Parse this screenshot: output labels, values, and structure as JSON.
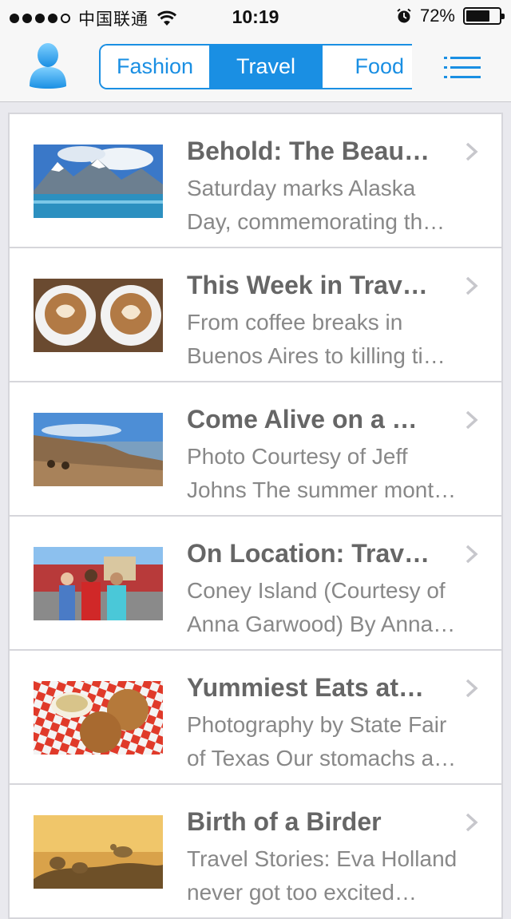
{
  "status_bar": {
    "carrier": "中国联通",
    "time": "10:19",
    "battery_text": "72%",
    "battery_level": 0.72
  },
  "nav": {
    "tabs": [
      {
        "label": "Fashion",
        "active": false
      },
      {
        "label": "Travel",
        "active": true
      },
      {
        "label": "Food",
        "active": false
      }
    ],
    "accent_color": "#1a8fe3"
  },
  "articles": [
    {
      "title": "Behold: The Beau…",
      "desc_line1": "Saturday marks Alaska",
      "desc_line2": "Day, commemorating th…",
      "thumb_icon": "mountain-lake-photo"
    },
    {
      "title": "This Week in Trav…",
      "desc_line1": "From coffee breaks in",
      "desc_line2": "Buenos Aires to killing ti…",
      "thumb_icon": "latte-cups-photo"
    },
    {
      "title": "Come Alive on a …",
      "desc_line1": "Photo Courtesy of Jeff",
      "desc_line2": "Johns The summer mont…",
      "thumb_icon": "beach-photo"
    },
    {
      "title": "On Location: Trav…",
      "desc_line1": "Coney Island (Courtesy of",
      "desc_line2": "Anna Garwood) By Anna…",
      "thumb_icon": "people-boardwalk-photo"
    },
    {
      "title": "Yummiest Eats at…",
      "desc_line1": "Photography by State Fair",
      "desc_line2": "of Texas Our stomachs a…",
      "thumb_icon": "fried-food-photo"
    },
    {
      "title": "Birth of a Birder",
      "desc_line1": "Travel Stories: Eva Holland",
      "desc_line2": "never got too excited…",
      "thumb_icon": "birds-sunset-photo"
    }
  ]
}
